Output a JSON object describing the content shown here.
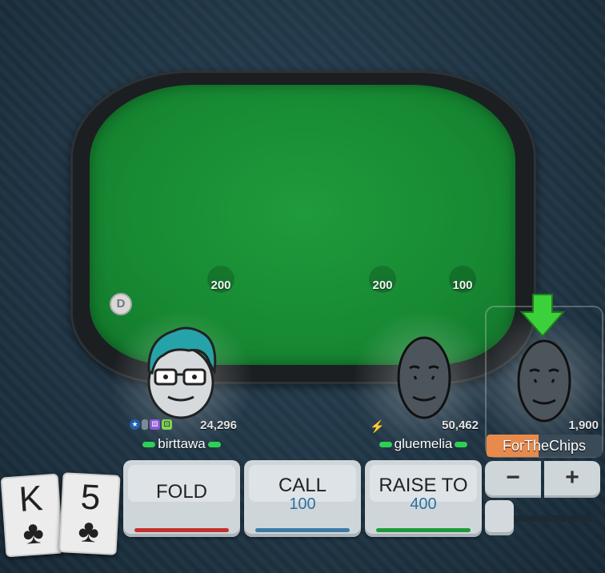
{
  "table": {
    "bets": [
      {
        "label": "200"
      },
      {
        "label": "200"
      },
      {
        "label": "100"
      }
    ],
    "dealer_button": "D"
  },
  "players": [
    {
      "name": "birttawa",
      "stack": "24,296"
    },
    {
      "name": "gluemelia",
      "stack": "50,462"
    },
    {
      "name": "ForTheChips",
      "stack": "1,900",
      "active": true,
      "timer_fraction": 0.45
    }
  ],
  "hand": {
    "cards": [
      {
        "rank": "K",
        "suit": "♣"
      },
      {
        "rank": "5",
        "suit": "♣"
      }
    ]
  },
  "actions": {
    "fold": {
      "label": "FOLD",
      "bar_color": "#c2312e"
    },
    "call": {
      "label": "CALL",
      "amount": "100",
      "bar_color": "#3f7aa6"
    },
    "raise": {
      "label": "RAISE TO",
      "amount": "400",
      "bar_color": "#1e9a3a"
    },
    "minus": "−",
    "plus": "+"
  },
  "icons": {
    "turn_indicator": "down-arrow-icon",
    "lightning": "lightning-icon"
  }
}
